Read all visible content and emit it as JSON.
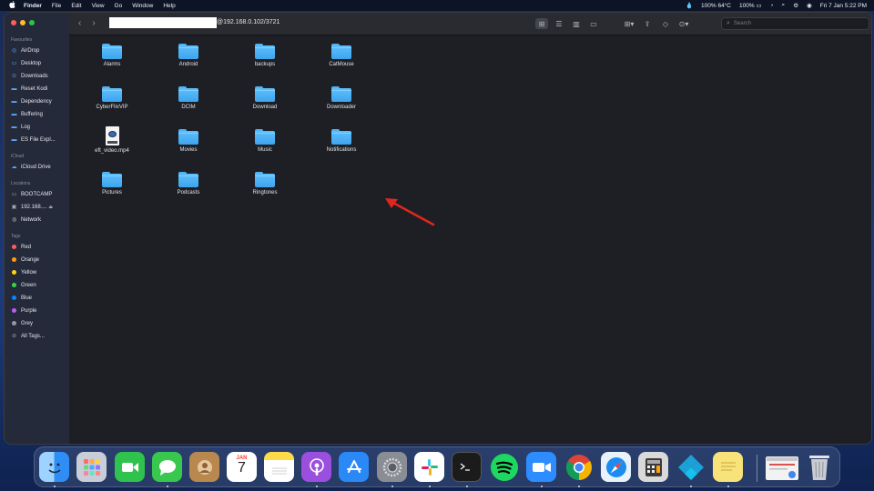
{
  "menubar": {
    "apple": "",
    "items": [
      "Finder",
      "File",
      "Edit",
      "View",
      "Go",
      "Window",
      "Help"
    ],
    "status": {
      "temp": "100% 64°C",
      "battery": "100%",
      "datetime": "Fri 7 Jan  5:22 PM"
    }
  },
  "window": {
    "path_suffix": "@192.168.0.102/3721",
    "search_placeholder": "Search"
  },
  "sidebar": {
    "favourites_label": "Favourites",
    "favourites": [
      "AirDrop",
      "Desktop",
      "Downloads",
      "Reset Kodi",
      "Dependency",
      "Buffering",
      "Log",
      "ES File Expl..."
    ],
    "icloud_label": "iCloud",
    "icloud": [
      "iCloud Drive"
    ],
    "locations_label": "Locations",
    "locations": [
      "BOOTCAMP",
      "192.168....",
      "Network"
    ],
    "tags_label": "Tags",
    "tags": [
      {
        "name": "Red",
        "color": "#ff5f57"
      },
      {
        "name": "Orange",
        "color": "#ff9f0a"
      },
      {
        "name": "Yellow",
        "color": "#ffd60a"
      },
      {
        "name": "Green",
        "color": "#32d74b"
      },
      {
        "name": "Blue",
        "color": "#0a84ff"
      },
      {
        "name": "Purple",
        "color": "#bf5af2"
      },
      {
        "name": "Grey",
        "color": "#98989d"
      },
      {
        "name": "All Tags...",
        "color": ""
      }
    ]
  },
  "files": [
    {
      "name": "Alarms",
      "kind": "folder"
    },
    {
      "name": "Android",
      "kind": "folder"
    },
    {
      "name": "backups",
      "kind": "folder"
    },
    {
      "name": "CatMouse",
      "kind": "folder"
    },
    {
      "name": "CyberFlixVIP",
      "kind": "folder"
    },
    {
      "name": "DCIM",
      "kind": "folder"
    },
    {
      "name": "Download",
      "kind": "folder"
    },
    {
      "name": "Downloader",
      "kind": "folder"
    },
    {
      "name": "eft_video.mp4",
      "kind": "file"
    },
    {
      "name": "Movies",
      "kind": "folder"
    },
    {
      "name": "Music",
      "kind": "folder"
    },
    {
      "name": "Notifications",
      "kind": "folder"
    },
    {
      "name": "Pictures",
      "kind": "folder"
    },
    {
      "name": "Podcasts",
      "kind": "folder"
    },
    {
      "name": "Ringtones",
      "kind": "folder"
    }
  ],
  "calendar_icon": {
    "month": "JAN",
    "day": "7"
  },
  "dock": [
    {
      "name": "finder",
      "icon": "finder-icon",
      "color": "#2f8ef5"
    },
    {
      "name": "launchpad",
      "icon": "launchpad-icon",
      "color": "#c8cdd8"
    },
    {
      "name": "facetime",
      "icon": "facetime-icon",
      "color": "#2fc24c"
    },
    {
      "name": "messages",
      "icon": "messages-icon",
      "color": "#38c84e"
    },
    {
      "name": "contacts",
      "icon": "contacts-icon",
      "color": "#b8884f"
    },
    {
      "name": "calendar",
      "icon": "calendar-icon",
      "color": "#ffffff"
    },
    {
      "name": "notes",
      "icon": "notes-icon",
      "color": "#fddb47"
    },
    {
      "name": "podcasts",
      "icon": "podcasts-icon",
      "color": "#9b4fdf"
    },
    {
      "name": "app-store",
      "icon": "app-store-icon",
      "color": "#2b88f7"
    },
    {
      "name": "system-preferences",
      "icon": "gear-icon",
      "color": "#8a8d94"
    },
    {
      "name": "slack",
      "icon": "slack-icon",
      "color": "#ffffff"
    },
    {
      "name": "terminal",
      "icon": "terminal-icon",
      "color": "#1b1b1b"
    },
    {
      "name": "spotify",
      "icon": "spotify-icon",
      "color": "#1ed760"
    },
    {
      "name": "zoom",
      "icon": "zoom-icon",
      "color": "#2d8cff"
    },
    {
      "name": "chrome",
      "icon": "chrome-icon",
      "color": "#ffffff"
    },
    {
      "name": "safari",
      "icon": "safari-icon",
      "color": "#e9f2fb"
    },
    {
      "name": "calculator",
      "icon": "calculator-icon",
      "color": "#d9d9d9"
    },
    {
      "name": "kodi",
      "icon": "kodi-icon",
      "color": "#1ba1d6"
    },
    {
      "name": "stickies",
      "icon": "stickies-icon",
      "color": "#f8e27a"
    },
    {
      "name": "recent-window",
      "icon": "window-thumbnail-icon",
      "color": "#f2f2f2"
    },
    {
      "name": "trash",
      "icon": "trash-icon",
      "color": "#c9ccd2"
    }
  ]
}
